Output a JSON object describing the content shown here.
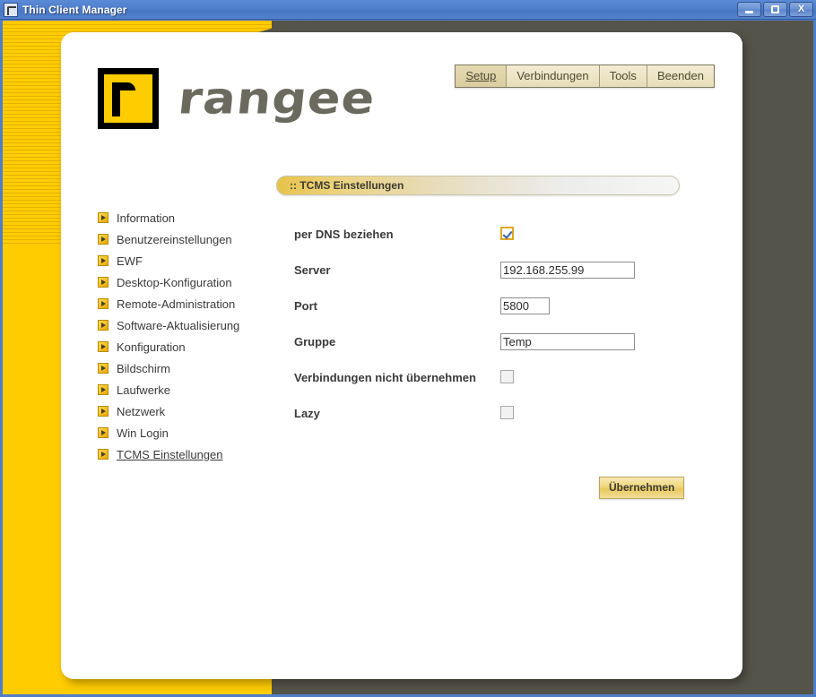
{
  "window": {
    "title": "Thin Client Manager",
    "icon": "app-logo-icon",
    "controls": {
      "minimize": "",
      "maximize": "",
      "close": "X"
    }
  },
  "brand": {
    "wordmark": "rangee",
    "mark": "rangee-logo-mark"
  },
  "menu": {
    "items": [
      {
        "label": "Setup",
        "active": true
      },
      {
        "label": "Verbindungen",
        "active": false
      },
      {
        "label": "Tools",
        "active": false
      },
      {
        "label": "Beenden",
        "active": false
      }
    ]
  },
  "panel": {
    "header": ":: TCMS Einstellungen"
  },
  "sidebar": {
    "items": [
      {
        "label": "Information",
        "active": false
      },
      {
        "label": "Benutzereinstellungen",
        "active": false
      },
      {
        "label": "EWF",
        "active": false
      },
      {
        "label": "Desktop-Konfiguration",
        "active": false
      },
      {
        "label": "Remote-Administration",
        "active": false
      },
      {
        "label": "Software-Aktualisierung",
        "active": false
      },
      {
        "label": "Konfiguration",
        "active": false
      },
      {
        "label": "Bildschirm",
        "active": false
      },
      {
        "label": "Laufwerke",
        "active": false
      },
      {
        "label": "Netzwerk",
        "active": false
      },
      {
        "label": "Win Login",
        "active": false
      },
      {
        "label": "TCMS Einstellungen",
        "active": true
      }
    ]
  },
  "form": {
    "dns": {
      "label": "per DNS beziehen",
      "checked": true
    },
    "server": {
      "label": "Server",
      "value": "192.168.255.99",
      "placeholder": ""
    },
    "port": {
      "label": "Port",
      "value": "5800",
      "placeholder": ""
    },
    "gruppe": {
      "label": "Gruppe",
      "value": "Temp",
      "placeholder": ""
    },
    "no_connections": {
      "label": "Verbindungen nicht übernehmen",
      "checked": false
    },
    "lazy": {
      "label": "Lazy",
      "checked": false
    },
    "apply_label": "Übernehmen"
  },
  "colors": {
    "brand_yellow": "#ffcc00",
    "olive": "#55544a",
    "titlebar_blue": "#4f7ec9",
    "accent_gold": "#e0a820"
  }
}
